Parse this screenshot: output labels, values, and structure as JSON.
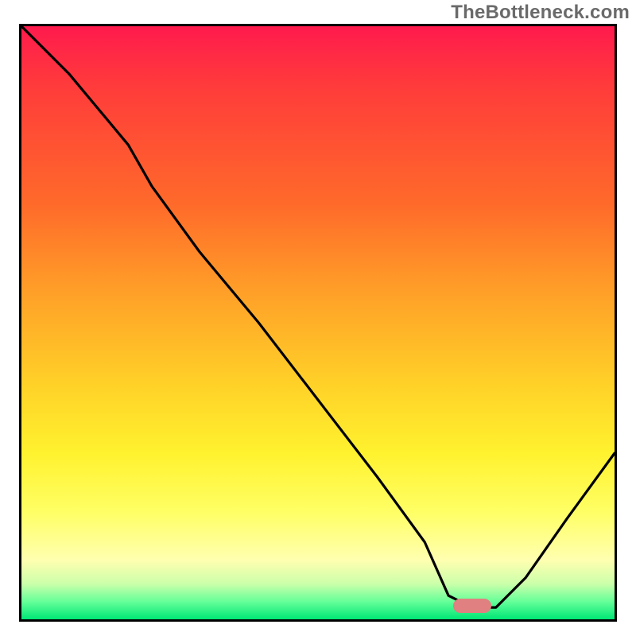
{
  "watermark": "TheBottleneck.com",
  "chart_data": {
    "type": "line",
    "title": "",
    "xlabel": "",
    "ylabel": "",
    "xlim": [
      0,
      100
    ],
    "ylim": [
      0,
      100
    ],
    "grid": false,
    "curve_note": "Black bottleneck curve: starts near top-left, descends steeply with a slight bend around x≈22, continues linearly to a flat minimum valley around x≈72–80 at y≈2, then rises toward x=100 y≈28.",
    "series": [
      {
        "name": "bottleneck-curve",
        "x": [
          0,
          8,
          18,
          22,
          30,
          40,
          50,
          60,
          68,
          72,
          76,
          80,
          85,
          92,
          100
        ],
        "y": [
          100,
          92,
          80,
          73,
          62,
          50,
          37,
          24,
          13,
          4,
          2,
          2,
          7,
          17,
          28
        ]
      }
    ],
    "marker": {
      "x_center": 76,
      "y": 2,
      "label": "optimal-range"
    },
    "gradient_stops": [
      {
        "pos": 0,
        "color": "#ff1a4d"
      },
      {
        "pos": 10,
        "color": "#ff3b3b"
      },
      {
        "pos": 30,
        "color": "#ff6a2a"
      },
      {
        "pos": 45,
        "color": "#ffa028"
      },
      {
        "pos": 60,
        "color": "#ffd028"
      },
      {
        "pos": 72,
        "color": "#fff22e"
      },
      {
        "pos": 82,
        "color": "#ffff66"
      },
      {
        "pos": 90,
        "color": "#ffffb0"
      },
      {
        "pos": 94,
        "color": "#ccffaa"
      },
      {
        "pos": 97,
        "color": "#66ff99"
      },
      {
        "pos": 100,
        "color": "#00e676"
      }
    ]
  }
}
